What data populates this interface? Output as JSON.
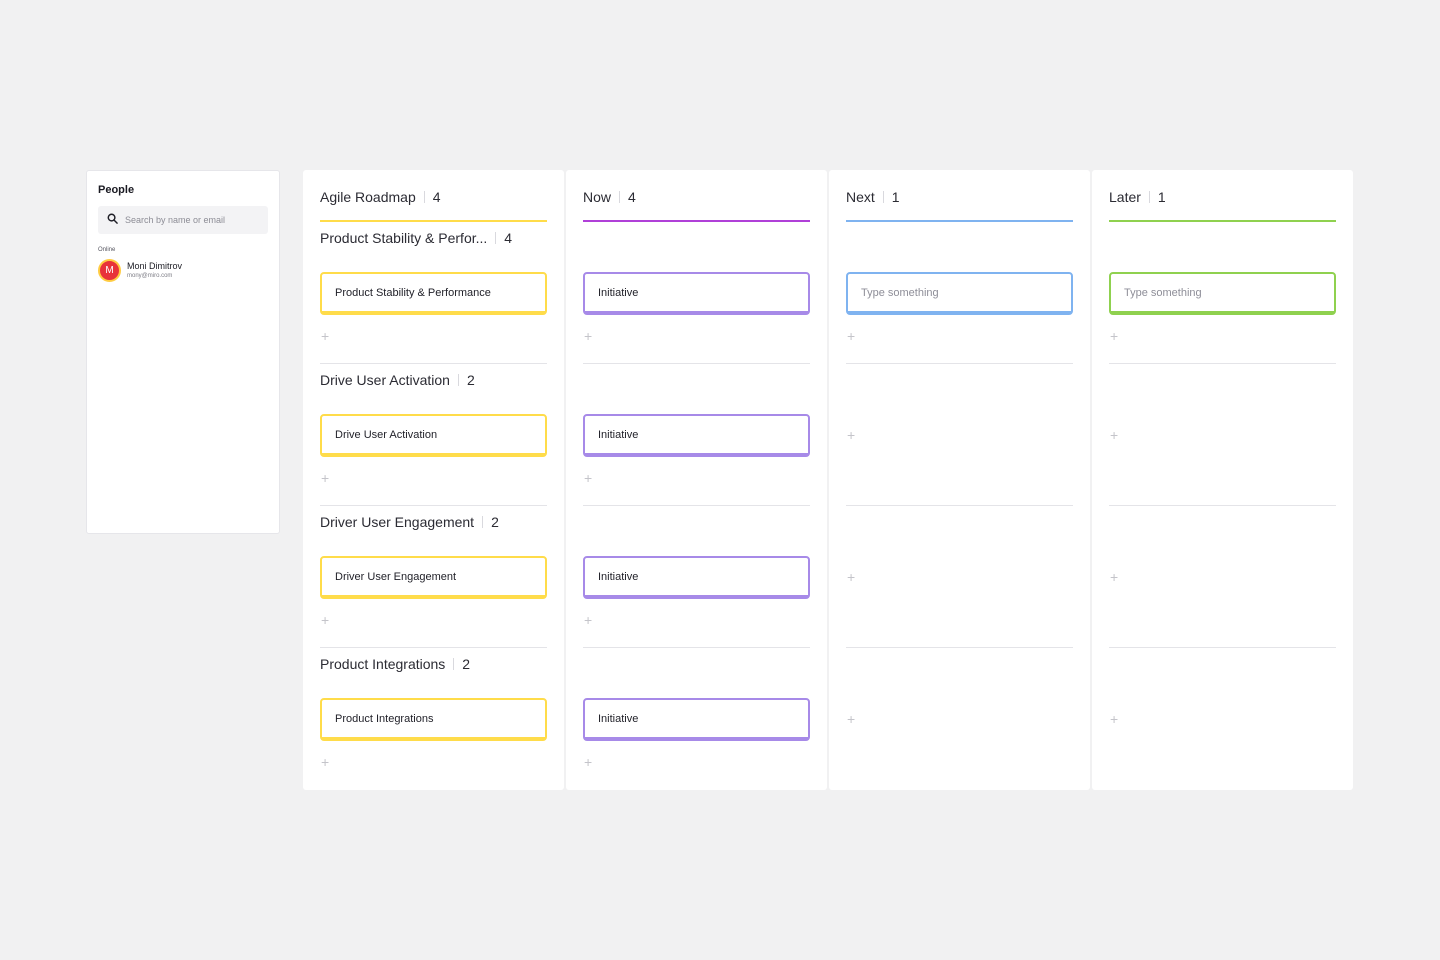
{
  "colors": {
    "yellow": "#ffdc4a",
    "purple": "#a78ae8",
    "purple_line": "#b040d8",
    "blue": "#7fb3f0",
    "green": "#8fd14f"
  },
  "people": {
    "title": "People",
    "search_placeholder": "Search by name or email",
    "section_label": "Online",
    "users": [
      {
        "initial": "M",
        "name": "Moni Dimitrov",
        "email": "mony@miro.com"
      }
    ]
  },
  "columns": [
    {
      "title": "Agile Roadmap",
      "count": "4",
      "lanes": [
        {
          "title": "Product Stability & Perfor...",
          "count": "4",
          "card": "Product Stability & Performance"
        },
        {
          "title": "Drive User Activation",
          "count": "2",
          "card": "Drive User Activation"
        },
        {
          "title": "Driver User Engagement",
          "count": "2",
          "card": "Driver User Engagement"
        },
        {
          "title": "Product Integrations",
          "count": "2",
          "card": "Product Integrations"
        }
      ]
    },
    {
      "title": "Now",
      "count": "4",
      "lanes": [
        {
          "card": "Initiative"
        },
        {
          "card": "Initiative"
        },
        {
          "card": "Initiative"
        },
        {
          "card": "Initiative"
        }
      ]
    },
    {
      "title": "Next",
      "count": "1",
      "lanes": [
        {
          "card_placeholder": "Type something"
        }
      ]
    },
    {
      "title": "Later",
      "count": "1",
      "lanes": [
        {
          "card_placeholder": "Type something"
        }
      ]
    }
  ]
}
